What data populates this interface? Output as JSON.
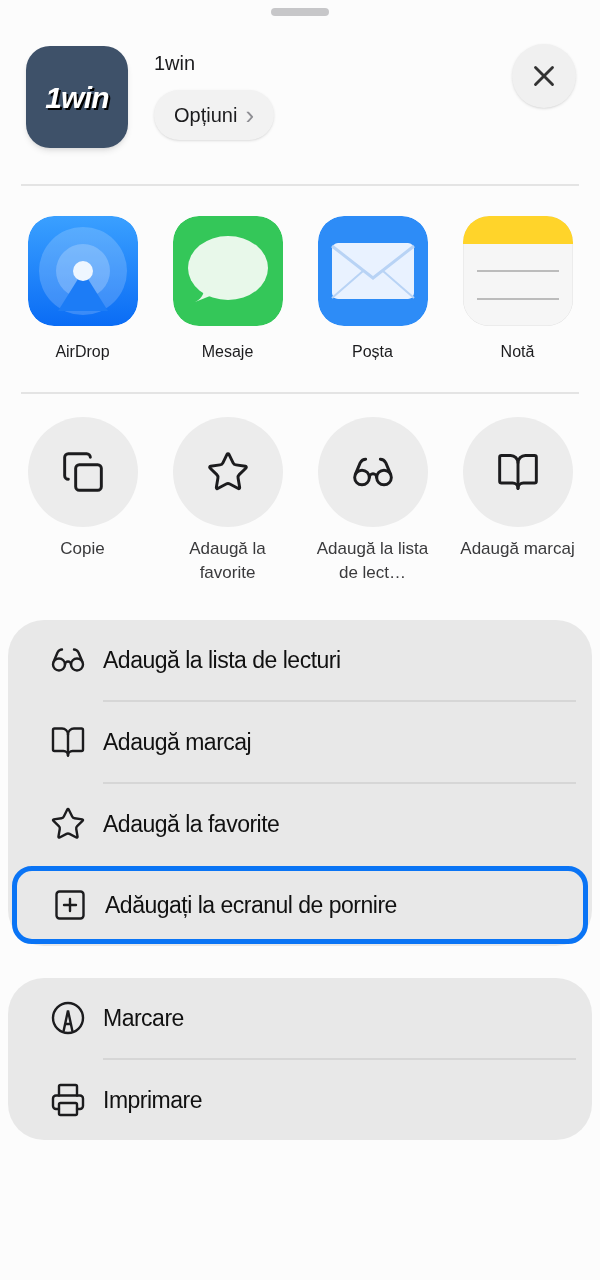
{
  "app": {
    "logo_text": "1win",
    "name": "1win",
    "options_label": "Opțiuni",
    "options_chevron": "›"
  },
  "share_targets": [
    {
      "kind": "airdrop",
      "label": "AirDrop"
    },
    {
      "kind": "messages",
      "label": "Mesaje"
    },
    {
      "kind": "mail",
      "label": "Poșta"
    },
    {
      "kind": "notes",
      "label": "Notă"
    }
  ],
  "quick_actions": [
    {
      "kind": "copy",
      "label": "Copie"
    },
    {
      "kind": "star",
      "label": "Adaugă la favorite"
    },
    {
      "kind": "glasses",
      "label": "Adaugă la lista de lect…"
    },
    {
      "kind": "book",
      "label": "Adaugă marcaj"
    }
  ],
  "action_groups": [
    {
      "items": [
        {
          "kind": "glasses",
          "label": "Adaugă la lista de lecturi",
          "selected": false
        },
        {
          "kind": "book",
          "label": "Adaugă marcaj",
          "selected": false
        },
        {
          "kind": "star",
          "label": "Adaugă la favorite",
          "selected": false
        },
        {
          "kind": "plus",
          "label": "Adăugați la ecranul de pornire",
          "selected": true
        }
      ]
    },
    {
      "items": [
        {
          "kind": "markup",
          "label": "Marcare",
          "selected": false
        },
        {
          "kind": "printer",
          "label": "Imprimare",
          "selected": false
        }
      ]
    }
  ]
}
